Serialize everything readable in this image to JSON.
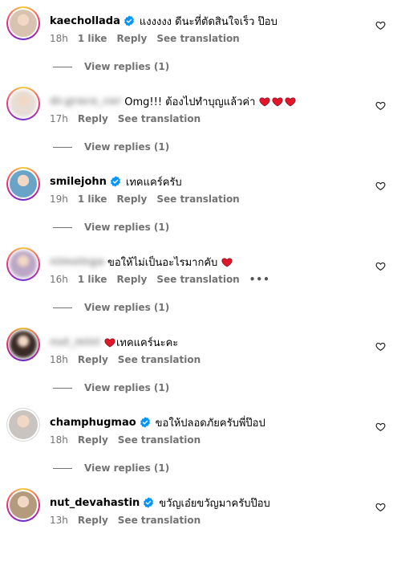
{
  "comments": [
    {
      "username": "kaechollada",
      "verified": true,
      "blurred": false,
      "text": "แงงงงง ดีนะที่ตัดสินใจเร็ว ป๊อบ",
      "hearts": 0,
      "time": "18h",
      "likes": "1 like",
      "reply": "Reply",
      "translate": "See translation",
      "view_replies": "View replies (1)",
      "avatar_color": "#d8c3b0"
    },
    {
      "username": "dr.grace_cer",
      "verified": false,
      "blurred": true,
      "text": "Omg!!! ต้องไปทำบุญแล้วค่า",
      "hearts": 3,
      "time": "17h",
      "likes": "",
      "reply": "Reply",
      "translate": "See translation",
      "view_replies": "View replies (1)",
      "avatar_color": "#e6ddd5"
    },
    {
      "username": "smilejohn",
      "verified": true,
      "blurred": false,
      "text": "เทคแคร์ครับ",
      "hearts": 0,
      "time": "19h",
      "likes": "1 like",
      "reply": "Reply",
      "translate": "See translation",
      "view_replies": "View replies (1)",
      "avatar_color": "#6aa3c8"
    },
    {
      "username": "nimolnga",
      "verified": false,
      "blurred": true,
      "text": "ขอให้ไม่เป็นอะไรมากคับ",
      "hearts": 1,
      "time": "16h",
      "likes": "1 like",
      "reply": "Reply",
      "translate": "See translation",
      "more": "•••",
      "view_replies": "View replies (1)",
      "avatar_color": "#bba7c6"
    },
    {
      "username": "nut_mini",
      "verified": false,
      "blurred": true,
      "text": "เทคแคร์นะคะ",
      "hearts_before": 1,
      "hearts": 0,
      "time": "18h",
      "likes": "",
      "reply": "Reply",
      "translate": "See translation",
      "view_replies": "View replies (1)",
      "avatar_color": "#3a2a26"
    },
    {
      "username": "champhugmao",
      "verified": true,
      "blurred": false,
      "text": "ขอให้ปลอดภัยครับพี่ป๊อป",
      "hearts": 0,
      "time": "18h",
      "likes": "",
      "reply": "Reply",
      "translate": "See translation",
      "view_replies": "View replies (1)",
      "avatar_color": "#c9c4bf"
    },
    {
      "username": "nut_devahastin",
      "verified": true,
      "blurred": false,
      "text": "ขวัญเอ๋ยขวัญมาครับป๊อบ",
      "hearts": 0,
      "time": "13h",
      "likes": "",
      "reply": "Reply",
      "translate": "See translation",
      "view_replies": "",
      "avatar_color": "#b59b7e"
    }
  ],
  "colors": {
    "verified_blue": "#0095f6",
    "heart_red": "#e0162b",
    "meta_gray": "#737373"
  },
  "icons": {
    "verified": "verified-badge-icon",
    "like": "heart-outline-icon",
    "reply_line": "reply-dash-icon"
  }
}
